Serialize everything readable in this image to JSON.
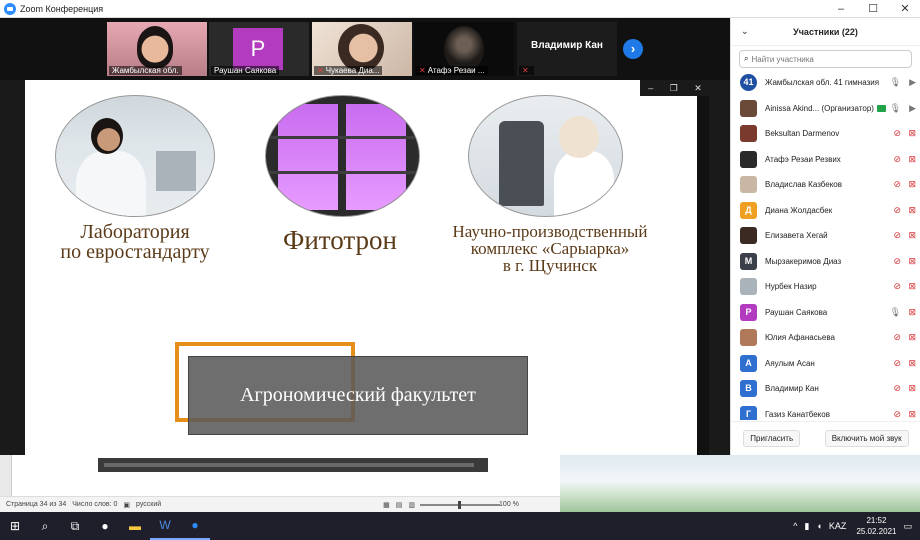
{
  "window": {
    "title": "Zoom Конференция"
  },
  "colors": {
    "accent": "#2d8cff",
    "muted": "#d8363a",
    "host_badge": "#22a34a",
    "caption": "#5b3a17",
    "frame": "#e58e1a"
  },
  "gallery": {
    "tiles": [
      {
        "name": "Жамбылская обл.",
        "muted": false
      },
      {
        "name": "Раушан Саякова",
        "avatar_letter": "P",
        "muted": false
      },
      {
        "name": "Чукаева Диа...",
        "muted": true
      },
      {
        "name": "Атафэ Резаи ...",
        "muted": true
      },
      {
        "name": "Владимир Кан",
        "muted": true
      }
    ],
    "next_icon": "chevron-right-icon"
  },
  "slide": {
    "captions": [
      {
        "line1": "Лаборатория",
        "line2": "по евростандарту"
      },
      {
        "line1": "Фитотрон"
      },
      {
        "line1": "Научно-производственный",
        "line2": "комплекс «Сарыарка»",
        "line3": "в г. Щучинск"
      }
    ],
    "faculty": "Агрономический факультет"
  },
  "panel": {
    "title": "Участники (22)",
    "search_placeholder": "Найти участника",
    "participants": [
      {
        "name": "Жамбылская обл. 41 гимназия (Я)",
        "avatar": "41",
        "color": "#1f4fa0",
        "mic": "on",
        "cam": "on"
      },
      {
        "name": "Ainissa Akind... (Организатор)",
        "avatar": "",
        "color": "#6b4a3a",
        "mic": "on",
        "cam": "on",
        "host": true
      },
      {
        "name": "Beksultan Darmenov",
        "avatar": "",
        "color": "#7a3b2e",
        "mic": "off",
        "cam": "off"
      },
      {
        "name": "Атафэ Резаи Резвих",
        "avatar": "",
        "color": "#2a2a2a",
        "mic": "off",
        "cam": "off"
      },
      {
        "name": "Владислав Казбеков",
        "avatar": "",
        "color": "#c9b7a3",
        "mic": "off",
        "cam": "off"
      },
      {
        "name": "Диана Жолдасбек",
        "avatar": "Д",
        "color": "#f0a020",
        "mic": "off",
        "cam": "off"
      },
      {
        "name": "Елизавета Хегай",
        "avatar": "",
        "color": "#3a2a22",
        "mic": "off",
        "cam": "off"
      },
      {
        "name": "Мырзакеримов Диаз",
        "avatar": "М",
        "color": "#3a3f4a",
        "mic": "off",
        "cam": "off"
      },
      {
        "name": "Нурбек Назир",
        "avatar": "",
        "color": "#a9b3b9",
        "mic": "off",
        "cam": "off"
      },
      {
        "name": "Раушан Саякова",
        "avatar": "Р",
        "color": "#b23bbf",
        "mic": "on",
        "cam": "off"
      },
      {
        "name": "Юлия Афанасьева",
        "avatar": "",
        "color": "#b07a5a",
        "mic": "off",
        "cam": "off"
      },
      {
        "name": "Аяулым Асан",
        "avatar": "А",
        "color": "#2f6fd0",
        "mic": "off",
        "cam": "off"
      },
      {
        "name": "Владимир Кан",
        "avatar": "В",
        "color": "#2f6fd0",
        "mic": "off",
        "cam": "off"
      },
      {
        "name": "Газиз Канатбеков",
        "avatar": "Г",
        "color": "#2f6fd0",
        "mic": "off",
        "cam": "off"
      }
    ],
    "invite_label": "Пригласить",
    "unmute_label": "Включить мой звук"
  },
  "word": {
    "page": "Страница 34 из 34",
    "words": "Число слов: 0",
    "language": "русский",
    "zoom": "100 %"
  },
  "taskbar": {
    "apps": [
      "windows-start-icon",
      "search-icon",
      "task-view-icon",
      "chrome-icon",
      "file-explorer-icon",
      "word-icon",
      "zoom-icon"
    ],
    "lang": "KAZ",
    "time": "21:52",
    "date": "25.02.2021"
  }
}
